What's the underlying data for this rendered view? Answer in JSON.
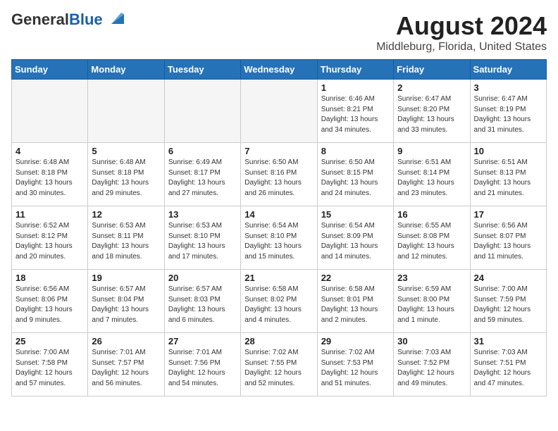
{
  "logo": {
    "general": "General",
    "blue": "Blue"
  },
  "title": "August 2024",
  "subtitle": "Middleburg, Florida, United States",
  "days_of_week": [
    "Sunday",
    "Monday",
    "Tuesday",
    "Wednesday",
    "Thursday",
    "Friday",
    "Saturday"
  ],
  "weeks": [
    [
      {
        "day": "",
        "info": ""
      },
      {
        "day": "",
        "info": ""
      },
      {
        "day": "",
        "info": ""
      },
      {
        "day": "",
        "info": ""
      },
      {
        "day": "1",
        "info": "Sunrise: 6:46 AM\nSunset: 8:21 PM\nDaylight: 13 hours\nand 34 minutes."
      },
      {
        "day": "2",
        "info": "Sunrise: 6:47 AM\nSunset: 8:20 PM\nDaylight: 13 hours\nand 33 minutes."
      },
      {
        "day": "3",
        "info": "Sunrise: 6:47 AM\nSunset: 8:19 PM\nDaylight: 13 hours\nand 31 minutes."
      }
    ],
    [
      {
        "day": "4",
        "info": "Sunrise: 6:48 AM\nSunset: 8:18 PM\nDaylight: 13 hours\nand 30 minutes."
      },
      {
        "day": "5",
        "info": "Sunrise: 6:48 AM\nSunset: 8:18 PM\nDaylight: 13 hours\nand 29 minutes."
      },
      {
        "day": "6",
        "info": "Sunrise: 6:49 AM\nSunset: 8:17 PM\nDaylight: 13 hours\nand 27 minutes."
      },
      {
        "day": "7",
        "info": "Sunrise: 6:50 AM\nSunset: 8:16 PM\nDaylight: 13 hours\nand 26 minutes."
      },
      {
        "day": "8",
        "info": "Sunrise: 6:50 AM\nSunset: 8:15 PM\nDaylight: 13 hours\nand 24 minutes."
      },
      {
        "day": "9",
        "info": "Sunrise: 6:51 AM\nSunset: 8:14 PM\nDaylight: 13 hours\nand 23 minutes."
      },
      {
        "day": "10",
        "info": "Sunrise: 6:51 AM\nSunset: 8:13 PM\nDaylight: 13 hours\nand 21 minutes."
      }
    ],
    [
      {
        "day": "11",
        "info": "Sunrise: 6:52 AM\nSunset: 8:12 PM\nDaylight: 13 hours\nand 20 minutes."
      },
      {
        "day": "12",
        "info": "Sunrise: 6:53 AM\nSunset: 8:11 PM\nDaylight: 13 hours\nand 18 minutes."
      },
      {
        "day": "13",
        "info": "Sunrise: 6:53 AM\nSunset: 8:10 PM\nDaylight: 13 hours\nand 17 minutes."
      },
      {
        "day": "14",
        "info": "Sunrise: 6:54 AM\nSunset: 8:10 PM\nDaylight: 13 hours\nand 15 minutes."
      },
      {
        "day": "15",
        "info": "Sunrise: 6:54 AM\nSunset: 8:09 PM\nDaylight: 13 hours\nand 14 minutes."
      },
      {
        "day": "16",
        "info": "Sunrise: 6:55 AM\nSunset: 8:08 PM\nDaylight: 13 hours\nand 12 minutes."
      },
      {
        "day": "17",
        "info": "Sunrise: 6:56 AM\nSunset: 8:07 PM\nDaylight: 13 hours\nand 11 minutes."
      }
    ],
    [
      {
        "day": "18",
        "info": "Sunrise: 6:56 AM\nSunset: 8:06 PM\nDaylight: 13 hours\nand 9 minutes."
      },
      {
        "day": "19",
        "info": "Sunrise: 6:57 AM\nSunset: 8:04 PM\nDaylight: 13 hours\nand 7 minutes."
      },
      {
        "day": "20",
        "info": "Sunrise: 6:57 AM\nSunset: 8:03 PM\nDaylight: 13 hours\nand 6 minutes."
      },
      {
        "day": "21",
        "info": "Sunrise: 6:58 AM\nSunset: 8:02 PM\nDaylight: 13 hours\nand 4 minutes."
      },
      {
        "day": "22",
        "info": "Sunrise: 6:58 AM\nSunset: 8:01 PM\nDaylight: 13 hours\nand 2 minutes."
      },
      {
        "day": "23",
        "info": "Sunrise: 6:59 AM\nSunset: 8:00 PM\nDaylight: 13 hours\nand 1 minute."
      },
      {
        "day": "24",
        "info": "Sunrise: 7:00 AM\nSunset: 7:59 PM\nDaylight: 12 hours\nand 59 minutes."
      }
    ],
    [
      {
        "day": "25",
        "info": "Sunrise: 7:00 AM\nSunset: 7:58 PM\nDaylight: 12 hours\nand 57 minutes."
      },
      {
        "day": "26",
        "info": "Sunrise: 7:01 AM\nSunset: 7:57 PM\nDaylight: 12 hours\nand 56 minutes."
      },
      {
        "day": "27",
        "info": "Sunrise: 7:01 AM\nSunset: 7:56 PM\nDaylight: 12 hours\nand 54 minutes."
      },
      {
        "day": "28",
        "info": "Sunrise: 7:02 AM\nSunset: 7:55 PM\nDaylight: 12 hours\nand 52 minutes."
      },
      {
        "day": "29",
        "info": "Sunrise: 7:02 AM\nSunset: 7:53 PM\nDaylight: 12 hours\nand 51 minutes."
      },
      {
        "day": "30",
        "info": "Sunrise: 7:03 AM\nSunset: 7:52 PM\nDaylight: 12 hours\nand 49 minutes."
      },
      {
        "day": "31",
        "info": "Sunrise: 7:03 AM\nSunset: 7:51 PM\nDaylight: 12 hours\nand 47 minutes."
      }
    ]
  ]
}
